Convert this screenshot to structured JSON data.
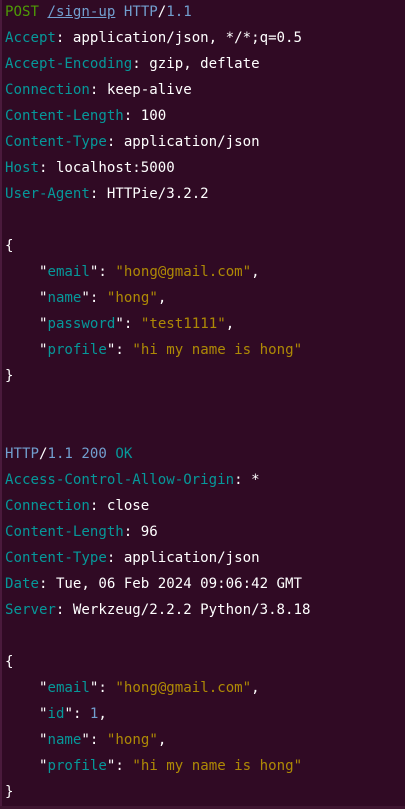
{
  "request": {
    "method": "POST",
    "path": "/sign-up",
    "protocol": "HTTP",
    "version": "1.1",
    "headers": [
      {
        "name": "Accept",
        "value": "application/json, */*;q=0.5"
      },
      {
        "name": "Accept-Encoding",
        "value": "gzip, deflate"
      },
      {
        "name": "Connection",
        "value": "keep-alive"
      },
      {
        "name": "Content-Length",
        "value": "100"
      },
      {
        "name": "Content-Type",
        "value": "application/json"
      },
      {
        "name": "Host",
        "value": "localhost:5000"
      },
      {
        "name": "User-Agent",
        "value": "HTTPie/3.2.2"
      }
    ],
    "body_open": "{",
    "body": [
      {
        "key": "email",
        "value": "hong@gmail.com",
        "type": "string"
      },
      {
        "key": "name",
        "value": "hong",
        "type": "string"
      },
      {
        "key": "password",
        "value": "test1111",
        "type": "string"
      },
      {
        "key": "profile",
        "value": "hi my name is hong",
        "type": "string"
      }
    ],
    "body_close": "}"
  },
  "response": {
    "protocol": "HTTP",
    "version": "1.1",
    "status_code": "200",
    "status_text": "OK",
    "headers": [
      {
        "name": "Access-Control-Allow-Origin",
        "value": "*"
      },
      {
        "name": "Connection",
        "value": "close"
      },
      {
        "name": "Content-Length",
        "value": "96"
      },
      {
        "name": "Content-Type",
        "value": "application/json"
      },
      {
        "name": "Date",
        "value": "Tue, 06 Feb 2024 09:06:42 GMT"
      },
      {
        "name": "Server",
        "value": "Werkzeug/2.2.2 Python/3.8.18"
      }
    ],
    "body_open": "{",
    "body": [
      {
        "key": "email",
        "value": "hong@gmail.com",
        "type": "string"
      },
      {
        "key": "id",
        "value": "1",
        "type": "number"
      },
      {
        "key": "name",
        "value": "hong",
        "type": "string"
      },
      {
        "key": "profile",
        "value": "hi my name is hong",
        "type": "string"
      }
    ],
    "body_close": "}"
  },
  "colors": {
    "background": "#300a24",
    "method": "#4e9a06",
    "protocol": "#729fcf",
    "header_key": "#06989a",
    "json_string": "#c4a000"
  }
}
